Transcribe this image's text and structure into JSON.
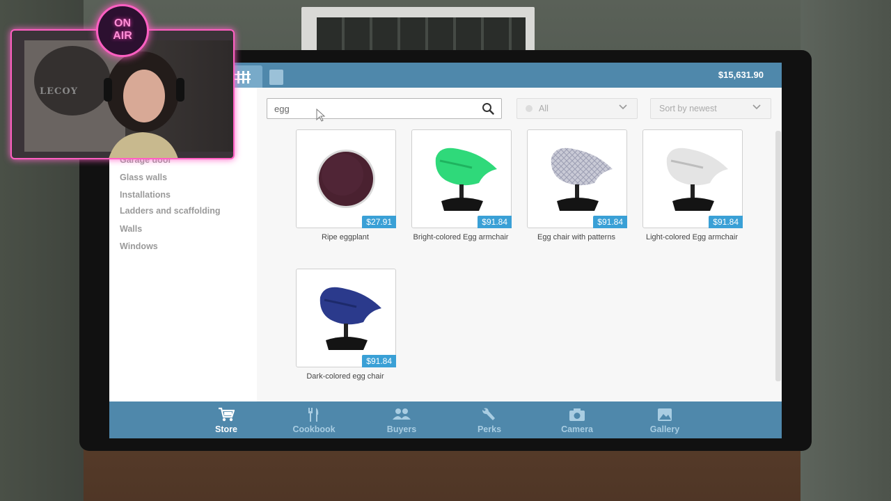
{
  "header": {
    "balance": "$15,631.90"
  },
  "sidebar": {
    "items": [
      {
        "label": "Garage door"
      },
      {
        "label": "Glass walls"
      },
      {
        "label": "Installations"
      },
      {
        "label": "Ladders and scaffolding"
      },
      {
        "label": "Walls"
      },
      {
        "label": "Windows"
      }
    ]
  },
  "search": {
    "value": "egg"
  },
  "filter": {
    "selected": "All"
  },
  "sort": {
    "selected": "Sort by newest"
  },
  "products": [
    {
      "name": "Ripe eggplant",
      "price": "$27.91"
    },
    {
      "name": "Bright-colored Egg armchair",
      "price": "$91.84"
    },
    {
      "name": "Egg chair with patterns",
      "price": "$91.84"
    },
    {
      "name": "Light-colored Egg armchair",
      "price": "$91.84"
    },
    {
      "name": "Dark-colored egg chair",
      "price": "$91.84"
    }
  ],
  "nav": {
    "items": [
      {
        "label": "Store",
        "icon": "cart-icon",
        "active": true
      },
      {
        "label": "Cookbook",
        "icon": "cutlery-icon",
        "active": false
      },
      {
        "label": "Buyers",
        "icon": "people-icon",
        "active": false
      },
      {
        "label": "Perks",
        "icon": "wrench-icon",
        "active": false
      },
      {
        "label": "Camera",
        "icon": "camera-icon",
        "active": false
      },
      {
        "label": "Gallery",
        "icon": "image-icon",
        "active": false
      }
    ]
  },
  "overlay": {
    "onair_line1": "ON",
    "onair_line2": "AIR",
    "logo_text": "LECOY"
  },
  "colors": {
    "bar": "#4f88ab",
    "price_badge": "#3aa0d6",
    "neon": "#ff5fc2"
  }
}
